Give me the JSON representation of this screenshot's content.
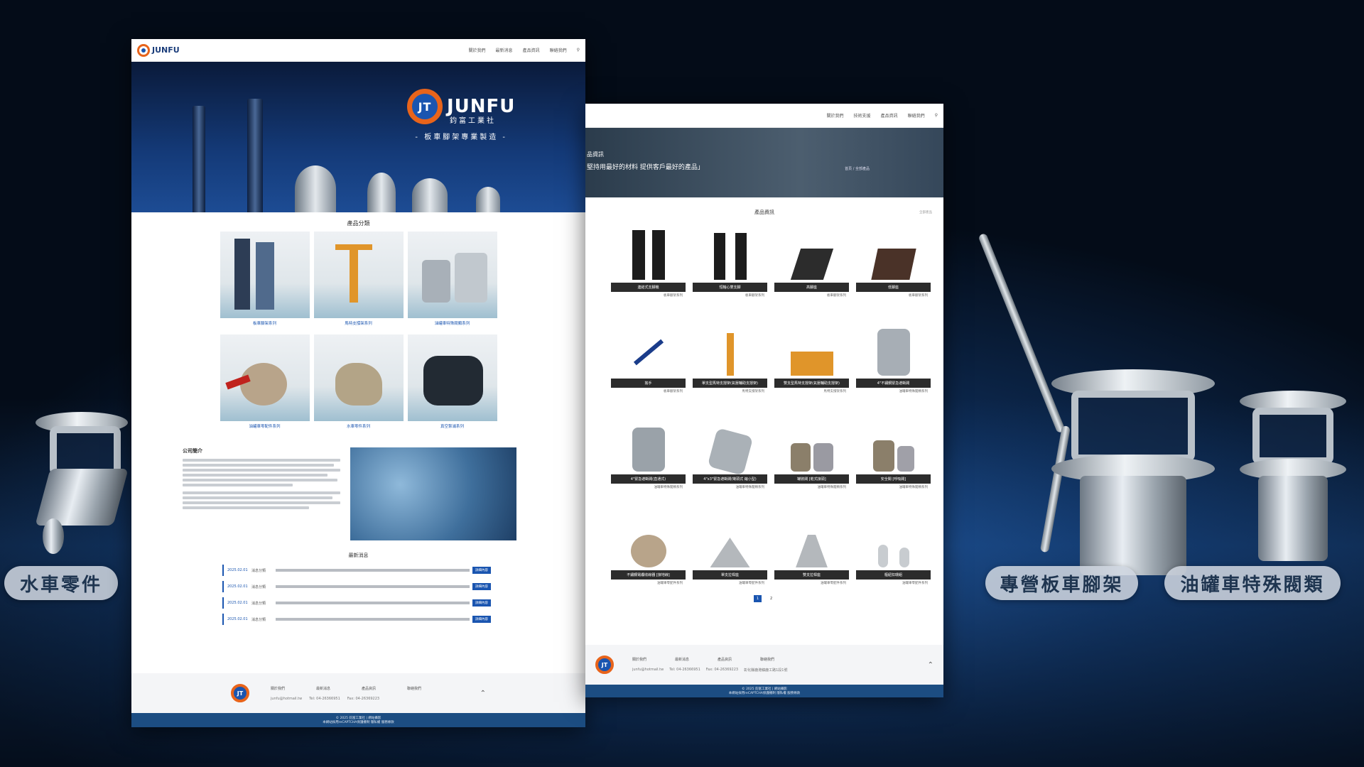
{
  "pills": {
    "left": "水車零件",
    "right1": "專營板車腳架",
    "right2": "油罐車特殊閥類"
  },
  "site1": {
    "nav": {
      "logo": "JUNFU",
      "links": [
        "關於我們",
        "最新消息",
        "產品資訊",
        "聯絡我們"
      ]
    },
    "hero": {
      "brand": "JUNFU",
      "brand_cn": "鈞富工業社",
      "slogan": "- 板車腳架專業製造 -"
    },
    "categories_title": "產品分類",
    "categories": [
      "板車腳架系列",
      "馬特支撐架系列",
      "油罐車特殊閥類系列",
      "油罐車零配件系列",
      "水車零件系列",
      "真空泵浦系列"
    ],
    "about_title": "公司簡介",
    "news_title": "最新消息",
    "news": [
      {
        "date": "2025.02.01",
        "tag": "消息分類",
        "btn": "詳細內容"
      },
      {
        "date": "2025.02.01",
        "tag": "消息分類",
        "btn": "詳細內容"
      },
      {
        "date": "2025.02.01",
        "tag": "消息分類",
        "btn": "詳細內容"
      },
      {
        "date": "2025.02.01",
        "tag": "消息分類",
        "btn": "詳細內容"
      }
    ],
    "footer": {
      "links": [
        "關於我們",
        "最新消息",
        "產品資訊",
        "聯絡我們"
      ],
      "email": "junfu@hotmail.tw",
      "tel": "Tel: 04-26366951",
      "fax": "Fax: 04-26369223",
      "copy": "© 2025 鈞富工業社 | 網站攝影",
      "copy2": "本網站採用reCAPTCHA保護機制 隱私權 服務條款"
    }
  },
  "site2": {
    "nav": {
      "links": [
        "關於我們",
        "技術支援",
        "產品資訊",
        "聯絡我們"
      ]
    },
    "hero": {
      "line1": "品資訊",
      "line2": "堅持用最好的材料 提供客戶最好的產品」",
      "crumb": "首頁 / 全部產品"
    },
    "title": "產品資訊",
    "title_right": "全部產品",
    "products": [
      {
        "name": "連結式支腳機",
        "cat": "板車腳架系列"
      },
      {
        "name": "短軸心雙支腳",
        "cat": "板車腳架系列"
      },
      {
        "name": "高腳座",
        "cat": "板車腳架系列"
      },
      {
        "name": "低腳座",
        "cat": "板車腳架系列"
      },
      {
        "name": "搖手",
        "cat": "板車腳架系列"
      },
      {
        "name": "單支型馬特支撐架(氣壓輔助支撐架)",
        "cat": "馬特支撐架系列"
      },
      {
        "name": "雙支型馬特支撐架(氣壓輔助支撐架)",
        "cat": "馬特支撐架系列"
      },
      {
        "name": "4\"不鏽鋼緊急遮斷閥",
        "cat": "油罐車特殊閥類系列"
      },
      {
        "name": "4\"緊急遮斷閥(直通式)",
        "cat": "油罐車特殊閥類系列"
      },
      {
        "name": "4\"x3\"緊急遮斷閥(彎頭式 縮小型)",
        "cat": "油罐車特殊閥類系列"
      },
      {
        "name": "罐裝閥 [乾式接頭]",
        "cat": "油罐車特殊閥類系列"
      },
      {
        "name": "安全閥 [呼吸閥]",
        "cat": "油罐車特殊閥類系列"
      },
      {
        "name": "不鏽鋼電纜收線器 [接地線]",
        "cat": "油罐車零配件系列"
      },
      {
        "name": "單支拉桿座",
        "cat": "油罐車零配件系列"
      },
      {
        "name": "雙支拉桿座",
        "cat": "油罐車零配件系列"
      },
      {
        "name": "樞紐扣環組",
        "cat": "油罐車零配件系列"
      }
    ],
    "pager": [
      "1",
      "2"
    ],
    "footer": {
      "links": [
        "關於我們",
        "最新消息",
        "產品資訊",
        "聯絡我們"
      ],
      "email": "junfu@hotmail.tw",
      "tel": "Tel: 04-26366951",
      "fax": "Fax: 04-26369223",
      "addr": "彰化縣鹿港鎮鹿工路1段1號",
      "copy": "© 2025 鈞富工業社 | 網站攝影",
      "copy2": "本網站採用reCAPTCHA保護機制 隱私權 服務條款"
    }
  },
  "colors": {
    "brand_blue": "#1a55b0",
    "brand_orange": "#e8641b",
    "footer_blue": "#1c4d82"
  }
}
